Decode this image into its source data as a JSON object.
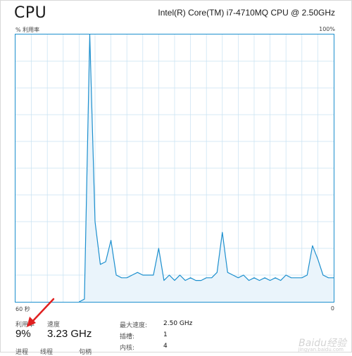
{
  "header": {
    "title": "CPU",
    "cpu_name": "Intel(R) Core(TM) i7-4710MQ CPU @ 2.50GHz"
  },
  "graph": {
    "y_label": "% 利用率",
    "y_max_label": "100%",
    "x_left_label": "60 秒",
    "x_right_label": "0",
    "line_color": "#1c8fce",
    "fill_color": "#eaf4fb",
    "grid_color": "#c7e2f2"
  },
  "chart_data": {
    "type": "area",
    "xlim": [
      60,
      0
    ],
    "ylim": [
      0,
      100
    ],
    "grid": true,
    "series": [
      {
        "values": [
          0,
          0,
          0,
          0,
          0,
          0,
          0,
          0,
          0,
          0,
          0,
          0,
          0,
          1,
          100,
          30,
          14,
          15,
          23,
          10,
          9,
          9,
          10,
          11,
          10,
          10,
          10,
          20,
          8,
          10,
          8,
          10,
          8,
          9,
          8,
          8,
          9,
          9,
          11,
          26,
          11,
          10,
          9,
          10,
          8,
          9,
          8,
          9,
          8,
          9,
          8,
          10,
          9,
          9,
          9,
          10,
          21,
          16,
          10,
          9,
          9
        ]
      }
    ]
  },
  "stats": {
    "utilization_label": "利用率",
    "utilization_value": "9%",
    "speed_label": "速度",
    "speed_value": "3.23 GHz",
    "processes_label": "进程",
    "threads_label": "线程",
    "handles_label": "句柄"
  },
  "specs": {
    "max_speed_key": "最大速度:",
    "max_speed_val": "2.50 GHz",
    "sockets_key": "插槽:",
    "sockets_val": "1",
    "cores_key": "内核:",
    "cores_val": "4"
  },
  "annotation": {
    "arrow_color": "#e02020"
  },
  "watermark": {
    "text": "Baidu经验",
    "sub": "jingyan.baidu.com"
  }
}
